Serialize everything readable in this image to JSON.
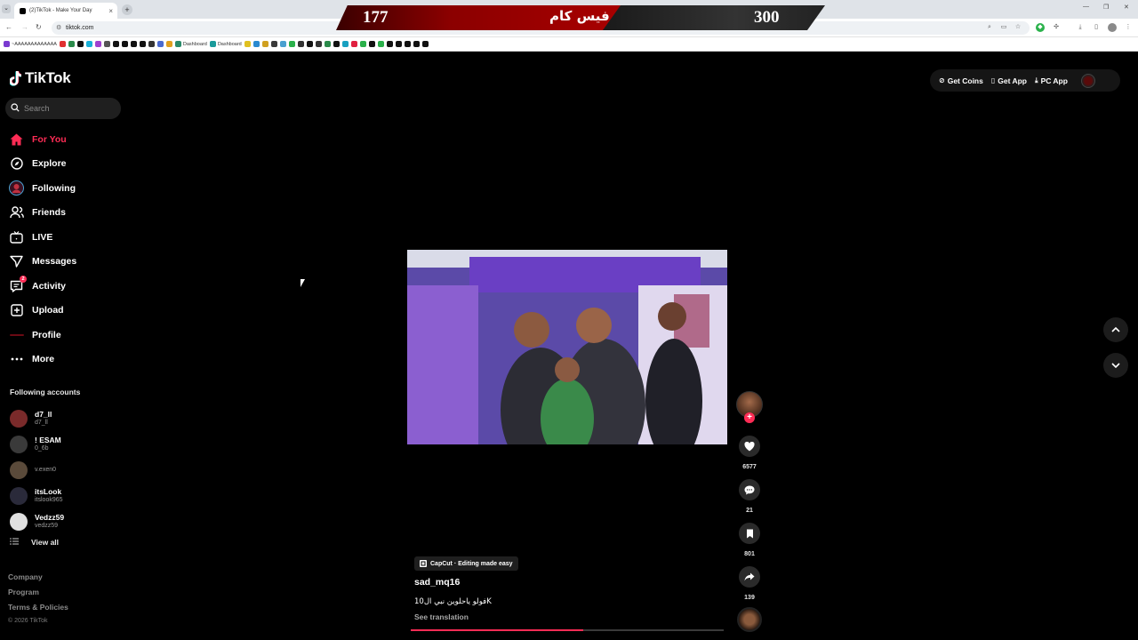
{
  "browser": {
    "tab_title": "(2)TikTok - Make Your Day",
    "url": "tiktok.com",
    "bookmarks": [
      "~AAAAAAAAAAAAA",
      "",
      "",
      "",
      "",
      "",
      "",
      "",
      "",
      "",
      "",
      "",
      "",
      "",
      "Dashboard",
      "Dashboard",
      "",
      "",
      "",
      "",
      "",
      "",
      "",
      "",
      "",
      "",
      "",
      "",
      "",
      "",
      "",
      "",
      "",
      "",
      "",
      "",
      ""
    ]
  },
  "overlay": {
    "left_score": "177",
    "title": "فيس كام",
    "right_score": "300",
    "colors": {
      "left": "#8b0000",
      "right": "#2a2a2a"
    }
  },
  "app": {
    "logo_text": "TikTok",
    "search_placeholder": "Search",
    "accent": "#fe2c55"
  },
  "nav": {
    "items": [
      {
        "label": "For You",
        "icon": "home-icon",
        "active": true
      },
      {
        "label": "Explore",
        "icon": "compass-icon"
      },
      {
        "label": "Following",
        "icon": "following-avatar-icon"
      },
      {
        "label": "Friends",
        "icon": "friends-icon"
      },
      {
        "label": "LIVE",
        "icon": "live-icon"
      },
      {
        "label": "Messages",
        "icon": "messages-icon"
      },
      {
        "label": "Activity",
        "icon": "activity-icon",
        "badge": "2"
      },
      {
        "label": "Upload",
        "icon": "upload-icon"
      },
      {
        "label": "Profile",
        "icon": "profile-icon"
      },
      {
        "label": "More",
        "icon": "more-icon"
      }
    ]
  },
  "following": {
    "title": "Following accounts",
    "accounts": [
      {
        "name": "d7_ll",
        "handle": "d7_ll",
        "color": "#7a2a2a"
      },
      {
        "name": "! ESAM",
        "handle": "0_6b",
        "color": "#3a3a3a"
      },
      {
        "name": "",
        "handle": "v.exen0",
        "color": "#5a4a3a"
      },
      {
        "name": "itsLook",
        "handle": "itslook965",
        "color": "#2a2a3a"
      },
      {
        "name": "Vedzz59",
        "handle": "vedzz59",
        "color": "#e0e0e0"
      }
    ],
    "view_all": "View all"
  },
  "footer": {
    "links": [
      "Company",
      "Program",
      "Terms & Policies"
    ],
    "copyright": "© 2026 TikTok"
  },
  "top_actions": {
    "get_coins": "Get Coins",
    "get_app": "Get App",
    "pc_app": "PC App"
  },
  "video": {
    "likes": "6577",
    "comments": "21",
    "saves": "801",
    "shares": "139",
    "capcut_label": "CapCut · Editing made easy",
    "author": "sad_mq16",
    "description": "فولو ياحلوين نبي ال10K",
    "see_translation": "See translation",
    "progress": 0.55
  }
}
